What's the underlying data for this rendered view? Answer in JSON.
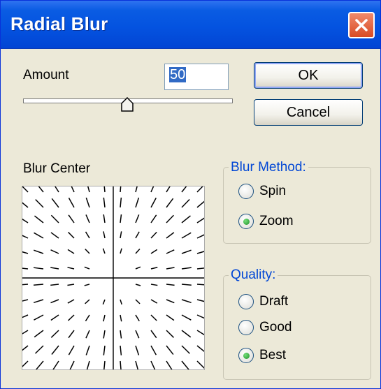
{
  "window": {
    "title": "Radial Blur"
  },
  "amount": {
    "label": "Amount",
    "value": "50",
    "slider_percent": 50
  },
  "buttons": {
    "ok": "OK",
    "cancel": "Cancel"
  },
  "blur_center": {
    "label": "Blur Center"
  },
  "blur_method": {
    "title": "Blur Method:",
    "options": [
      {
        "label": "Spin",
        "checked": false
      },
      {
        "label": "Zoom",
        "checked": true
      }
    ]
  },
  "quality": {
    "title": "Quality:",
    "options": [
      {
        "label": "Draft",
        "checked": false
      },
      {
        "label": "Good",
        "checked": false
      },
      {
        "label": "Best",
        "checked": true
      }
    ]
  },
  "colors": {
    "title_bar": "#0453e0",
    "close_button": "#d94b24",
    "dialog_bg": "#ece9d8",
    "group_title": "#0046d5"
  }
}
